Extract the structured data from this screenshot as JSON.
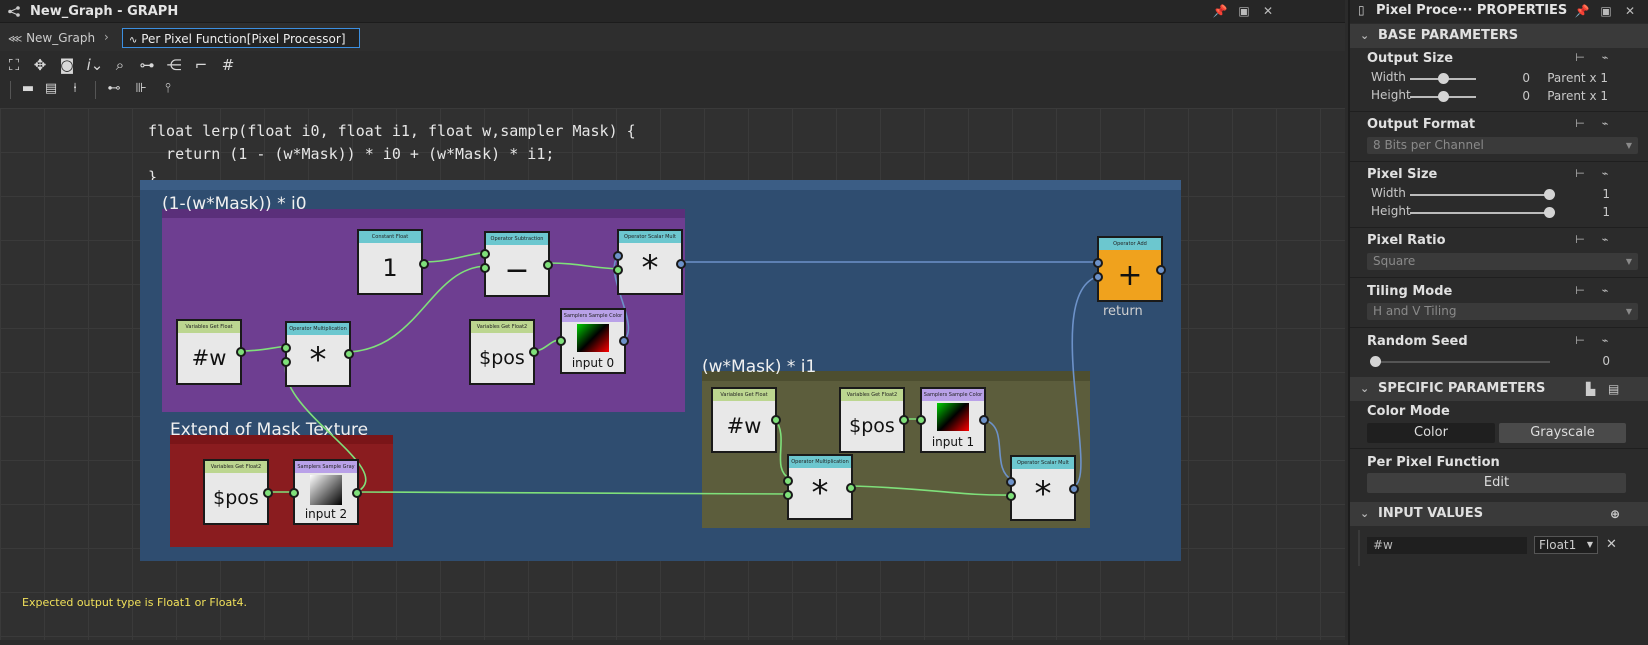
{
  "graph_pane": {
    "title": "New_Graph - GRAPH",
    "breadcrumb": [
      "New_Graph",
      "Per Pixel Function[Pixel Processor]"
    ]
  },
  "code": {
    "line1": "float lerp(float i0, float i1, float w,sampler Mask) {",
    "line2": "  return (1 - (w*Mask)) * i0 + (w*Mask) * i1;",
    "line3": "}"
  },
  "frames": {
    "purple": "(1-(w*Mask)) * i0",
    "red": "Extend of Mask Texture",
    "olive": "(w*Mask) * i1"
  },
  "nodes": {
    "const_float": {
      "header": "Constant Float",
      "label": "1"
    },
    "op_sub": {
      "header": "Operator Subtraction",
      "label": "−"
    },
    "op_scale1": {
      "header": "Operator Scalar Mult",
      "label": "*"
    },
    "var_w1": {
      "header": "Variables Get Float",
      "label": "#w"
    },
    "op_mult1": {
      "header": "Operator Multiplication",
      "label": "*"
    },
    "var_pos1": {
      "header": "Variables Get Float2",
      "label": "$pos"
    },
    "sampler0": {
      "header": "Samplers Sample Color",
      "label": "input 0"
    },
    "op_add": {
      "header": "Operator Add",
      "label": "+"
    },
    "return_label": "return",
    "var_pos2": {
      "header": "Variables Get Float2",
      "label": "$pos"
    },
    "sampler2": {
      "header": "Samplers Sample Gray",
      "label": "input 2"
    },
    "var_w2": {
      "header": "Variables Get Float",
      "label": "#w"
    },
    "var_pos3": {
      "header": "Variables Get Float2",
      "label": "$pos"
    },
    "sampler1": {
      "header": "Samplers Sample Color",
      "label": "input 1"
    },
    "op_mult2": {
      "header": "Operator Multiplication",
      "label": "*"
    },
    "op_scale2": {
      "header": "Operator Scalar Mult",
      "label": "*"
    }
  },
  "status": "Expected output type is Float1 or Float4.",
  "properties": {
    "title": "Pixel Proce··· PROPERTIES",
    "base_section": "BASE PARAMETERS",
    "output_size": {
      "label": "Output Size",
      "width_label": "Width",
      "height_label": "Height",
      "width_value": "0",
      "height_value": "0",
      "width_rel": "Parent x 1",
      "height_rel": "Parent x 1"
    },
    "output_format": {
      "label": "Output Format",
      "value": "8 Bits per Channel"
    },
    "pixel_size": {
      "label": "Pixel Size",
      "width_label": "Width",
      "height_label": "Height",
      "width_value": "1",
      "height_value": "1"
    },
    "pixel_ratio": {
      "label": "Pixel Ratio",
      "value": "Square"
    },
    "tiling_mode": {
      "label": "Tiling Mode",
      "value": "H and V Tiling"
    },
    "random_seed": {
      "label": "Random Seed",
      "value": "0"
    },
    "specific_section": "SPECIFIC PARAMETERS",
    "color_mode": {
      "label": "Color Mode",
      "option_color": "Color",
      "option_gray": "Grayscale"
    },
    "per_pixel": {
      "label": "Per Pixel Function",
      "button": "Edit"
    },
    "input_section": "INPUT VALUES",
    "input_value": {
      "name": "#w",
      "type": "Float1"
    }
  },
  "colors": {
    "purple_frame": "#6e3e91",
    "red_frame": "#8a1c1f",
    "olive_frame": "#5c5d3c",
    "blue_frame": "#2f4d70",
    "add_node": "#f0a21d",
    "pin_green": "#7fe07a",
    "pin_blue": "#6d92c9"
  }
}
